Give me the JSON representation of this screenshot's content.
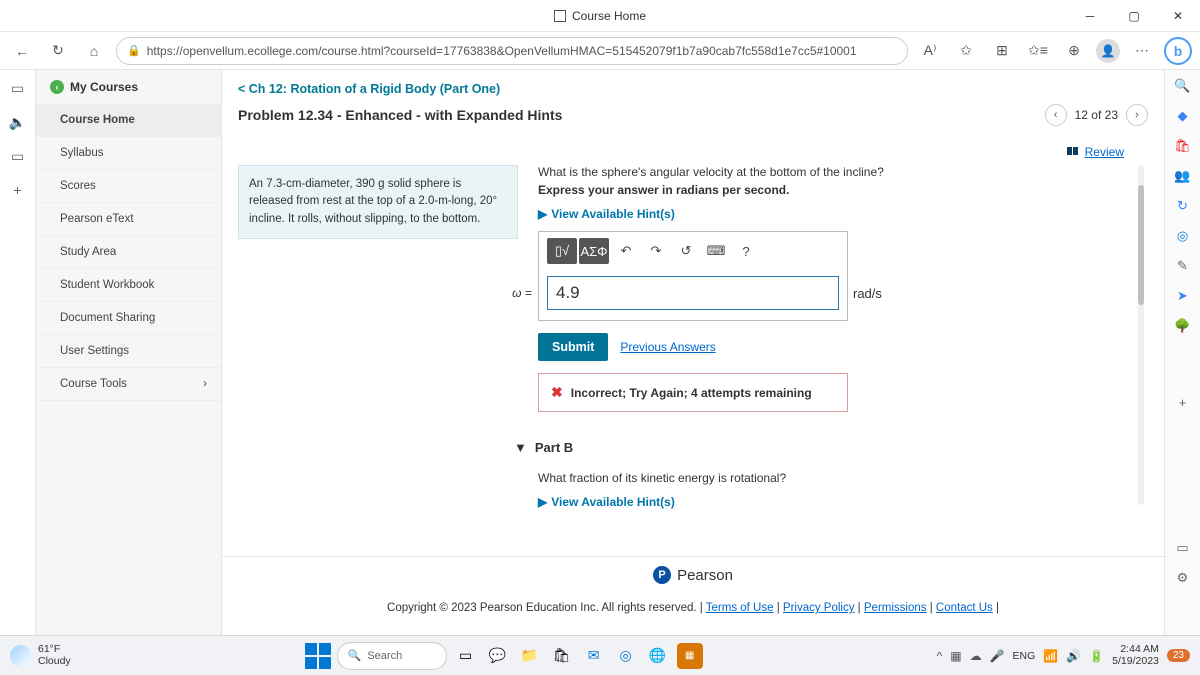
{
  "titlebar": {
    "title": "Course Home"
  },
  "addrbar": {
    "url": "https://openvellum.ecollege.com/course.html?courseId=17763838&OpenVellumHMAC=515452079f1b7a90cab7fc558d1e7cc5#10001"
  },
  "sidebar": {
    "header": "My Courses",
    "items": [
      "Course Home",
      "Syllabus",
      "Scores",
      "Pearson eText",
      "Study Area",
      "Student Workbook",
      "Document Sharing",
      "User Settings",
      "Course Tools"
    ]
  },
  "content": {
    "chapter_link": "< Ch 12: Rotation of a Rigid Body (Part One)",
    "problem_title": "Problem 12.34 - Enhanced - with Expanded Hints",
    "pager": "12 of 23",
    "review": "Review",
    "description": "An 7.3-cm-diameter, 390 g solid sphere is released from rest at the top of a 2.0-m-long, 20° incline. It rolls, without slipping, to the bottom.",
    "question": "What is the sphere's angular velocity at the bottom of the incline?",
    "instruction": "Express your answer in radians per second.",
    "hints": "View Available Hint(s)",
    "omega": "ω =",
    "answer_value": "4.9",
    "unit": "rad/s",
    "toolbar_greek": "ΑΣΦ",
    "submit": "Submit",
    "prev_answers": "Previous Answers",
    "feedback": "Incorrect; Try Again; 4 attempts remaining",
    "part_b_label": "Part B",
    "part_b_q": "What fraction of its kinetic energy is rotational?",
    "pearson": "Pearson",
    "copyright": "Copyright © 2023 Pearson Education Inc. All rights reserved. |",
    "links": {
      "terms": "Terms of Use",
      "privacy": "Privacy Policy",
      "permissions": "Permissions",
      "contact": "Contact Us"
    }
  },
  "taskbar": {
    "weather_temp": "61°F",
    "weather_desc": "Cloudy",
    "search": "Search",
    "lang": "ENG",
    "time": "2:44 AM",
    "date": "5/19/2023",
    "notif": "23"
  }
}
